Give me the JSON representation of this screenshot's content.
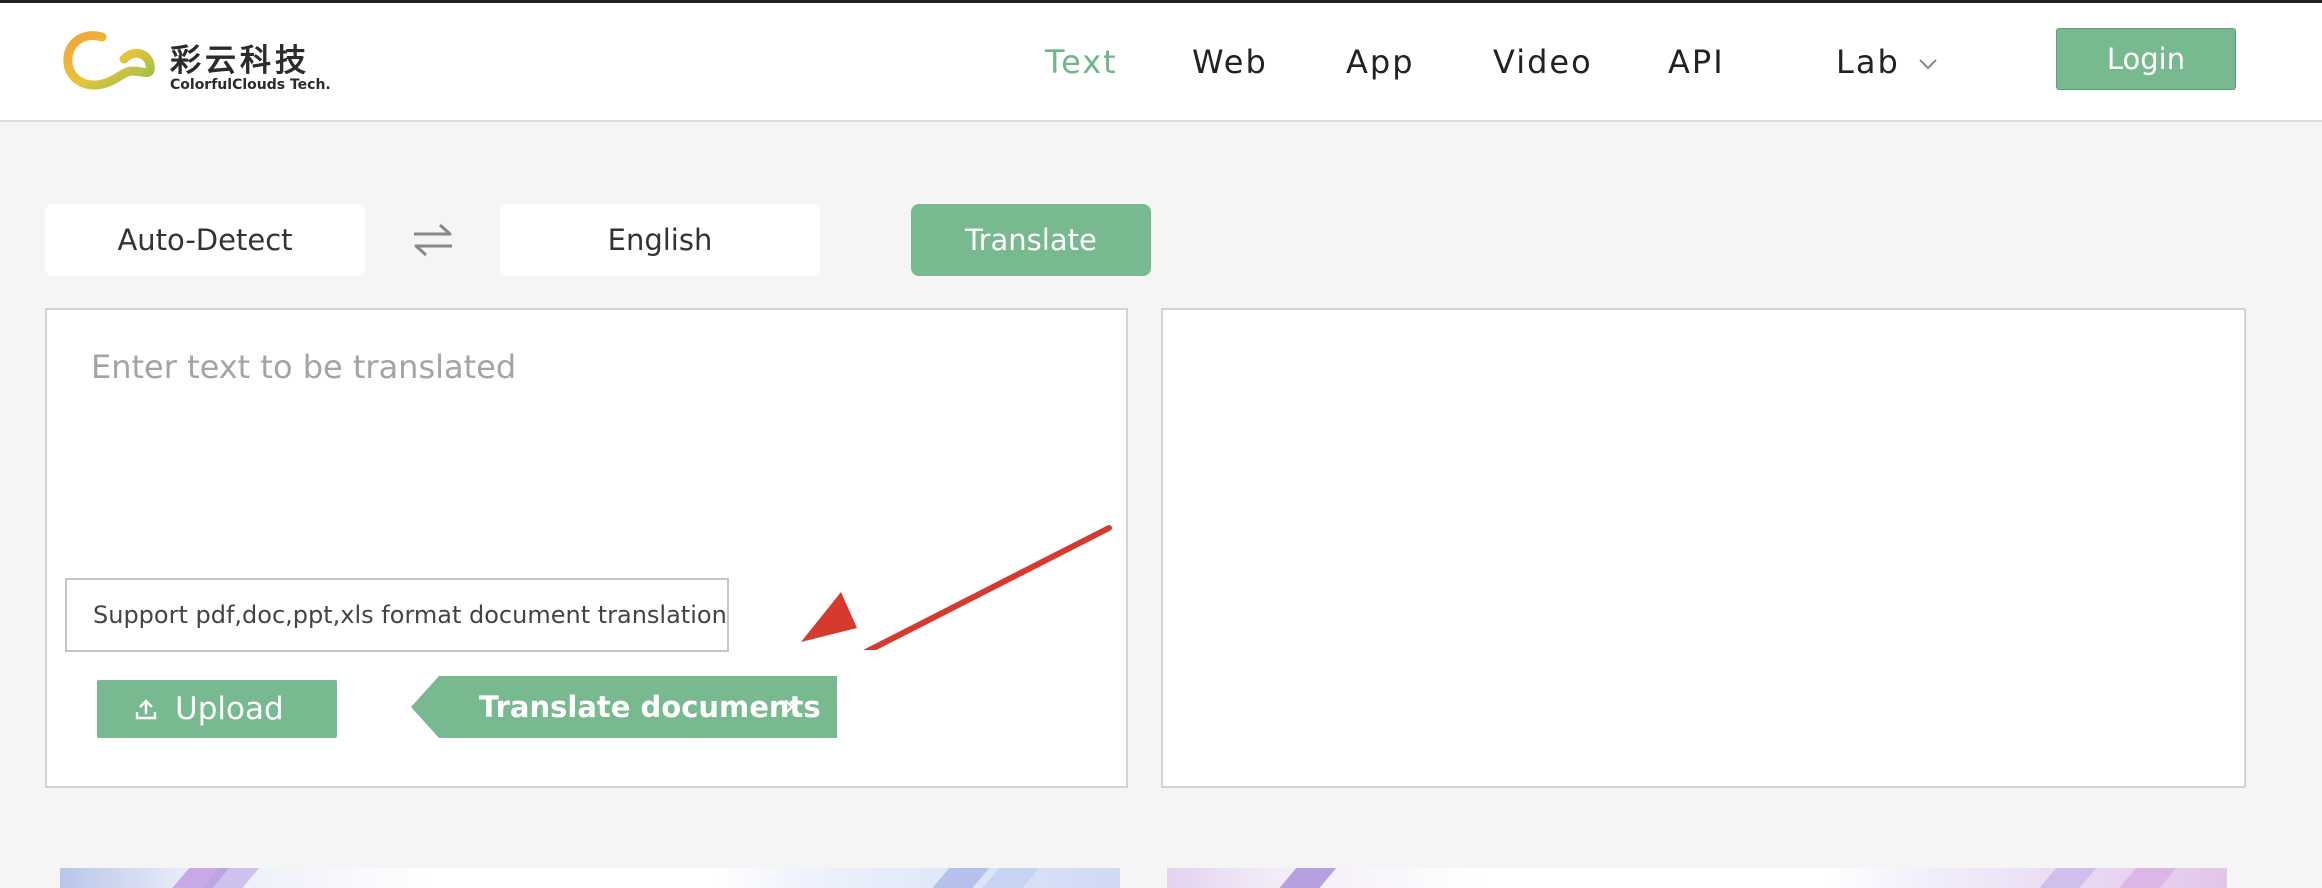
{
  "brand": {
    "name_cn": "彩云科技",
    "name_en": "ColorfulClouds Tech.",
    "colors": {
      "orange": "#f2a53a",
      "yellow": "#e7c43a",
      "green": "#8fc04e"
    }
  },
  "nav": {
    "items": [
      {
        "label": "Text",
        "active": true
      },
      {
        "label": "Web",
        "active": false
      },
      {
        "label": "App",
        "active": false
      },
      {
        "label": "Video",
        "active": false
      },
      {
        "label": "API",
        "active": false
      },
      {
        "label": "Lab",
        "active": false,
        "has_dropdown": true
      }
    ],
    "login_label": "Login"
  },
  "toolbar": {
    "source_language": "Auto-Detect",
    "target_language": "English",
    "swap_icon": "swap-arrows-icon",
    "translate_label": "Translate"
  },
  "input_panel": {
    "value": "",
    "placeholder": "Enter text to be translated",
    "support_tip": "Support pdf,doc,ppt,xls format document translation",
    "upload_label": "Upload",
    "upload_icon": "upload-icon",
    "doc_tag_label": "Translate documents",
    "doc_tag_close": "×"
  },
  "output_panel": {
    "value": ""
  },
  "colors": {
    "accent": "#78b990",
    "nav_active": "#6fb68c",
    "annotation_arrow": "#d63a2f",
    "background": "#f5f5f5"
  }
}
